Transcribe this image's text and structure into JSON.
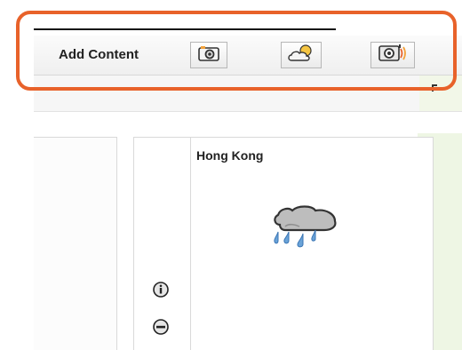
{
  "toolbar": {
    "add_content_label": "Add Content",
    "buttons": [
      {
        "name": "photo-widget",
        "icon": "camera-icon"
      },
      {
        "name": "weather-widget",
        "icon": "cloud-sun-icon"
      },
      {
        "name": "media-widget",
        "icon": "speaker-icon"
      }
    ]
  },
  "widget": {
    "title": "Hong Kong",
    "condition_icon": "rain-cloud-icon",
    "controls": [
      {
        "name": "info",
        "icon": "info-icon"
      },
      {
        "name": "remove",
        "icon": "minus-circle-icon"
      }
    ]
  },
  "colors": {
    "highlight": "#e8622a",
    "toolbar_bg": "#f4f4f4",
    "accent_green": "#eef6e4"
  }
}
